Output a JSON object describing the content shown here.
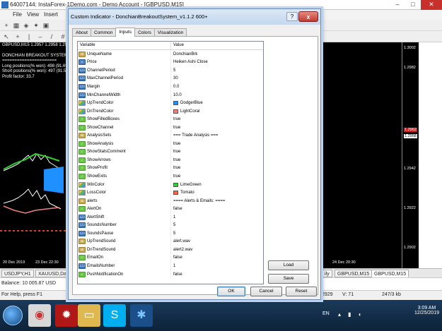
{
  "app": {
    "title": "64007144: InstaForex-1Demo.com - Demo Account - [GBPUSD,M15]",
    "menu": [
      "File",
      "View",
      "Insert"
    ]
  },
  "chart": {
    "symbol_line": "GBPUSD,M15  1.2957 1.2958 1.2954",
    "info_lines": [
      "DONCHIAN BREAKOUT SYSTEM(",
      "======================",
      "Long positions(% won): 498 (91.6%",
      "Short positions(% won): 497 (91.5%",
      "Profit factor: 33.7"
    ],
    "price_labels": [
      "1.3002",
      "1.2982",
      "1.2962",
      "1.2958",
      "1.2942",
      "1.2922",
      "1.2902"
    ],
    "time_labels": [
      "20 Dec 2019",
      "23 Dec 22:30",
      "24 Dec 20:30",
      "29 Dec 20:30"
    ]
  },
  "bottom_tabs": [
    "USDJPY,H1",
    "XAUUSD,Dai",
    "ily",
    "GBPUSD,M15",
    "GBPUSD,M15"
  ],
  "terminal": {
    "balance": "Balance: 10 005.87 USD"
  },
  "statusbar": {
    "help": "For Help, press F1",
    "value1": "2929",
    "value2": "V: 71",
    "traffic": "247/3 kb"
  },
  "taskbar": {
    "language": "EN",
    "time": "3:09 AM",
    "date": "12/25/2019"
  },
  "dialog": {
    "title": "Custom Indicator - DonchianBreakoutSystem_v1.1.2 600+",
    "help_label": "?",
    "close_label": "x",
    "tabs": [
      "About",
      "Common",
      "Inputs",
      "Colors",
      "Visualization"
    ],
    "active_tab": "Inputs",
    "grid_headers": {
      "variable": "Variable",
      "value": "Value"
    },
    "rows": [
      {
        "icon": "str",
        "name": "UniqueName",
        "value": "DonchianBrk"
      },
      {
        "icon": "enum",
        "name": "Price",
        "value": "Heiken Ashi Close"
      },
      {
        "icon": "num",
        "name": "ChannelPeriod",
        "value": "5"
      },
      {
        "icon": "num",
        "name": "MaxChannelPeriod",
        "value": "30"
      },
      {
        "icon": "num",
        "name": "Margin",
        "value": "0.0"
      },
      {
        "icon": "num",
        "name": "MinChannelWidth",
        "value": "10.0"
      },
      {
        "icon": "color",
        "name": "UpTrendColor",
        "value": "DodgerBlue",
        "swatch": "#1e90ff"
      },
      {
        "icon": "color",
        "name": "DnTrendColor",
        "value": "LightCoral",
        "swatch": "#f08080"
      },
      {
        "icon": "bool",
        "name": "ShowFilledBoxes",
        "value": "true"
      },
      {
        "icon": "bool",
        "name": "ShowChannel",
        "value": "true"
      },
      {
        "icon": "str",
        "name": "AnalysisSets",
        "value": "=== Trade Analysis ==="
      },
      {
        "icon": "bool",
        "name": "ShowAnalysis",
        "value": "true"
      },
      {
        "icon": "bool",
        "name": "ShowStatsComment",
        "value": "true"
      },
      {
        "icon": "bool",
        "name": "ShowArrows",
        "value": "true"
      },
      {
        "icon": "bool",
        "name": "ShowProfit",
        "value": "true"
      },
      {
        "icon": "bool",
        "name": "ShowExits",
        "value": "true"
      },
      {
        "icon": "color",
        "name": "WinColor",
        "value": "LimeGreen",
        "swatch": "#32cd32"
      },
      {
        "icon": "color",
        "name": "LossColor",
        "value": "Tomato",
        "swatch": "#ff6347"
      },
      {
        "icon": "str",
        "name": "alerts",
        "value": "==== Alerts & Emails: ===="
      },
      {
        "icon": "bool",
        "name": "AlertOn",
        "value": "false"
      },
      {
        "icon": "num",
        "name": "AlertShift",
        "value": "1"
      },
      {
        "icon": "num",
        "name": "SoundsNumber",
        "value": "5"
      },
      {
        "icon": "num",
        "name": "SoundsPause",
        "value": "5"
      },
      {
        "icon": "str",
        "name": "UpTrendSound",
        "value": "alert.wav"
      },
      {
        "icon": "str",
        "name": "DnTrendSound",
        "value": "alert2.wav"
      },
      {
        "icon": "bool",
        "name": "EmailOn",
        "value": "false"
      },
      {
        "icon": "num",
        "name": "EmailsNumber",
        "value": "1"
      },
      {
        "icon": "bool",
        "name": "PushNotificationOn",
        "value": "false"
      }
    ],
    "buttons": {
      "load": "Load",
      "save": "Save",
      "ok": "OK",
      "cancel": "Cancel",
      "reset": "Reset"
    }
  }
}
